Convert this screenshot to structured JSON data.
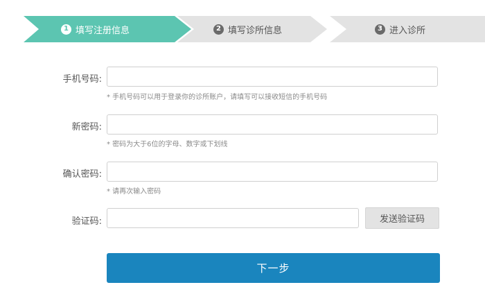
{
  "steps": [
    {
      "number": "1",
      "label": "填写注册信息",
      "active": true
    },
    {
      "number": "2",
      "label": "填写诊所信息",
      "active": false
    },
    {
      "number": "3",
      "label": "进入诊所",
      "active": false
    }
  ],
  "colors": {
    "step_active": "#5cc5b1",
    "step_inactive": "#e3e3e3",
    "primary_button": "#1a85be",
    "secondary_button": "#e3e3e3"
  },
  "form": {
    "phone": {
      "label": "手机号码:",
      "value": "",
      "hint": "* 手机号码可以用于登录你的诊所账户，请填写可以接收短信的手机号码"
    },
    "new_password": {
      "label": "新密码:",
      "value": "",
      "hint": "* 密码为大于6位的字母、数字或下划线"
    },
    "confirm_password": {
      "label": "确认密码:",
      "value": "",
      "hint": "* 请再次输入密码"
    },
    "verification_code": {
      "label": "验证码:",
      "value": "",
      "send_button": "发送验证码"
    },
    "next_button": "下一步"
  }
}
